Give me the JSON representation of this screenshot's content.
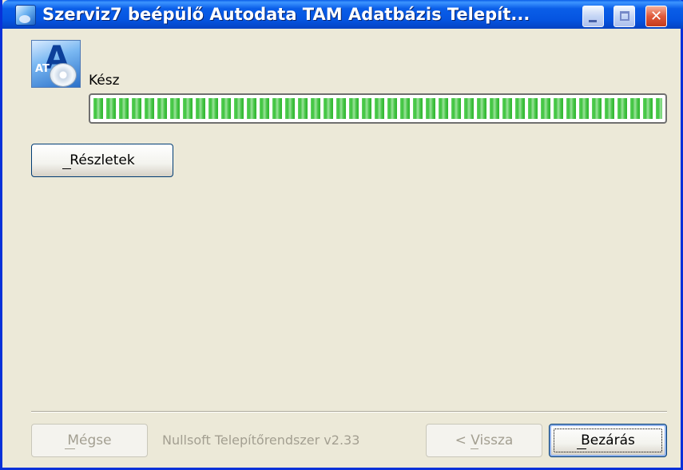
{
  "window": {
    "title": "Szerviz7 beépülő Autodata TAM Adatbázis Telepít..."
  },
  "titlebar_buttons": {
    "minimize": "minimize",
    "maximize": "maximize",
    "close": "✕"
  },
  "status": {
    "label": "Kész",
    "progress": 1.0
  },
  "buttons": {
    "details": "Részletek",
    "cancel": "Mégse",
    "back": "< Vissza",
    "close": "Bezárás"
  },
  "branding": "Nullsoft Telepítőrendszer v2.33",
  "icons": {
    "title_icon": "installer-app-icon",
    "status_icon": "autodata-disc-icon"
  }
}
